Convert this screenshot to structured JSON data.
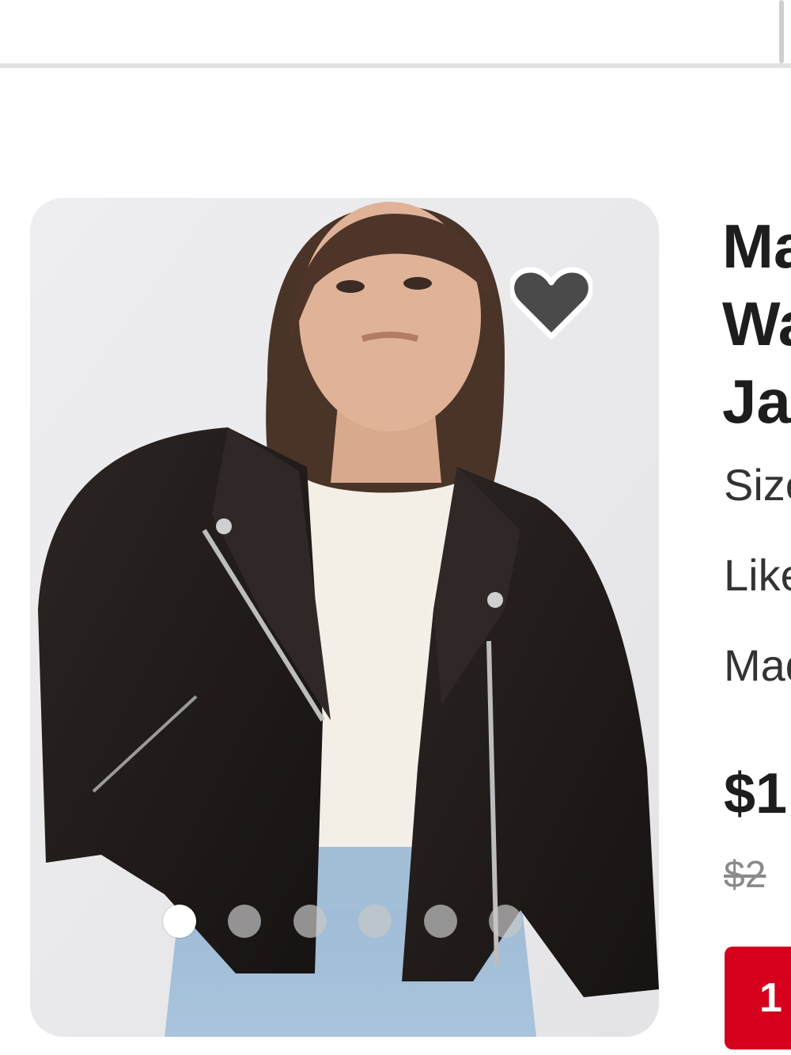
{
  "product": {
    "title_lines": [
      "Madewell",
      "Washed Leather",
      "Jacket"
    ],
    "size": "Size XS",
    "condition": "Like New",
    "brand": "Madewell",
    "price": "$1",
    "original_price": "$2",
    "button_label": "1"
  },
  "gallery": {
    "image_count": 6,
    "active_index": 0
  },
  "colors": {
    "accent": "#d5001c",
    "heart_fill": "#4a4a4a"
  },
  "icons": {
    "favorite": "heart-icon"
  }
}
